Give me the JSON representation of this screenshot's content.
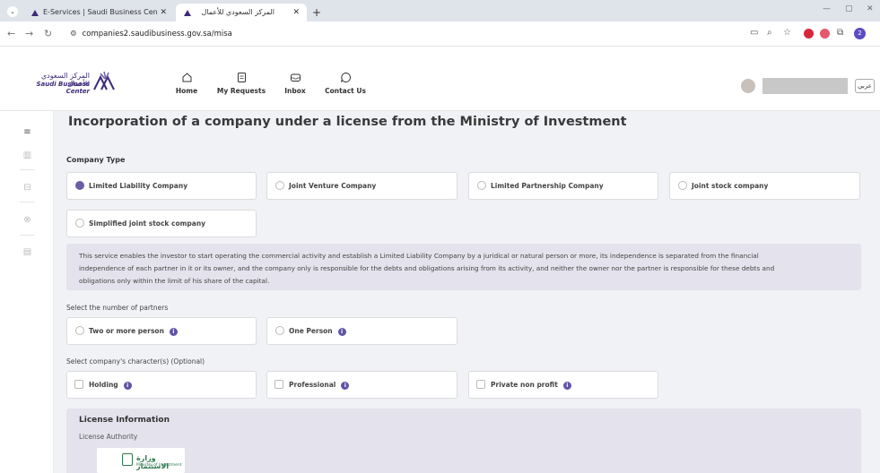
{
  "browser": {
    "tabs": [
      {
        "title": "E-Services | Saudi Business Cen",
        "active": false
      },
      {
        "title": "المركز السعودي للأعمال",
        "active": true
      }
    ],
    "url": "companies2.saudibusiness.gov.sa/misa"
  },
  "header": {
    "logo_ar": "المركز السعودي للأعمال",
    "logo_en": "Saudi Business Center",
    "nav": [
      {
        "label": "Home",
        "icon": "home-icon"
      },
      {
        "label": "My Requests",
        "icon": "document-icon"
      },
      {
        "label": "Inbox",
        "icon": "inbox-icon"
      },
      {
        "label": "Contact Us",
        "icon": "chat-icon"
      }
    ],
    "language_button": "عربي"
  },
  "main": {
    "title": "Incorporation of a company under a license from the Ministry of Investment",
    "company_type": {
      "label": "Company Type",
      "options": [
        {
          "label": "Limited Liability Company",
          "selected": true
        },
        {
          "label": "Joint Venture Company",
          "selected": false
        },
        {
          "label": "Limited Partnership Company",
          "selected": false
        },
        {
          "label": "Joint stock company",
          "selected": false
        },
        {
          "label": "Simplified joint stock company",
          "selected": false
        }
      ]
    },
    "description_lines": [
      "This service enables the investor to start operating the commercial activity and establish a Limited Liability Company by a juridical or natural person or more, its independence is separated from the financial",
      "independence of each partner in it or its owner, and the company only is responsible for the debts and obligations arising from its activity, and neither the owner nor the partner is responsible for these debts and",
      "obligations only within the limit of his share of the capital."
    ],
    "partners": {
      "label": "Select the number of partners",
      "options": [
        {
          "label": "Two or more person"
        },
        {
          "label": "One Person"
        }
      ]
    },
    "characters": {
      "label": "Select company's character(s) (Optional)",
      "options": [
        {
          "label": "Holding"
        },
        {
          "label": "Professional"
        },
        {
          "label": "Private non profit"
        }
      ]
    },
    "license": {
      "title": "License Information",
      "authority_label": "License Authority",
      "authority_logo_ar": "وزارة الاستثمار",
      "authority_logo_en": "Ministry of Investment"
    }
  },
  "colors": {
    "accent": "#6b5ea6",
    "info_icon": "#5f54a6",
    "panel": "#e4e2ec",
    "page_bg": "#f1f2f6"
  }
}
